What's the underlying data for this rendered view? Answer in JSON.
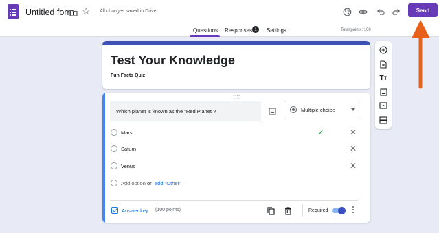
{
  "header": {
    "title": "Untitled form",
    "saved_status": "All changes saved in Drive",
    "send_label": "Send",
    "icons": [
      "forms-app-icon",
      "folder-icon",
      "star-icon",
      "palette-icon",
      "preview-eye-icon",
      "undo-icon",
      "redo-icon"
    ]
  },
  "tabs": {
    "questions": "Questions",
    "responses": "Responses",
    "responses_count": "1",
    "settings": "Settings",
    "active": "Questions"
  },
  "total_points": "Total points: 100",
  "form": {
    "title": "Test Your Knowledge",
    "description": "Fun Facts Quiz"
  },
  "question": {
    "text": "Which planet is known as the \"Red Planet ?",
    "type": "Multiple choice",
    "options": [
      {
        "label": "Mars",
        "correct": true
      },
      {
        "label": "Saturn",
        "correct": false
      },
      {
        "label": "Venus",
        "correct": false
      }
    ],
    "add_option": "Add option",
    "or": "or",
    "add_other": "add \"Other\"",
    "answer_key": "Answer key",
    "points": "(100 points)",
    "required_label": "Required",
    "required": true
  },
  "side_toolbar": [
    "add-question-icon",
    "import-questions-icon",
    "add-title-icon",
    "add-image-icon",
    "add-video-icon",
    "add-section-icon"
  ],
  "colors": {
    "brand": "#673ab7",
    "title_bar": "#3f51b5",
    "active_question": "#4285f4",
    "background": "#e8eaf6",
    "annotation_arrow": "#e8611a"
  }
}
